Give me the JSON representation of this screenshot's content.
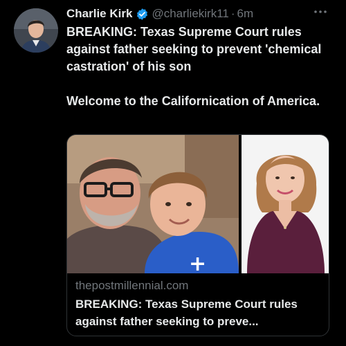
{
  "tweet": {
    "author": {
      "display_name": "Charlie Kirk",
      "handle": "@charliekirk11",
      "separator": "·",
      "time": "6m",
      "verified": true,
      "avatar_icon": "avatar-photo"
    },
    "more_icon": "more-dots-icon",
    "text": {
      "paragraph_1": "BREAKING: Texas Supreme Court rules against father seeking to prevent 'chemical castration' of his son",
      "paragraph_2": "Welcome to the Californication of America."
    },
    "card": {
      "domain": "thepostmillennial.com",
      "title": "BREAKING: Texas Supreme Court rules against father seeking to preve..."
    }
  },
  "colors": {
    "background": "#000000",
    "text_primary": "#e7e9ea",
    "text_secondary": "#71767b",
    "verified_blue": "#1d9bf0",
    "card_border": "#2f3336"
  }
}
